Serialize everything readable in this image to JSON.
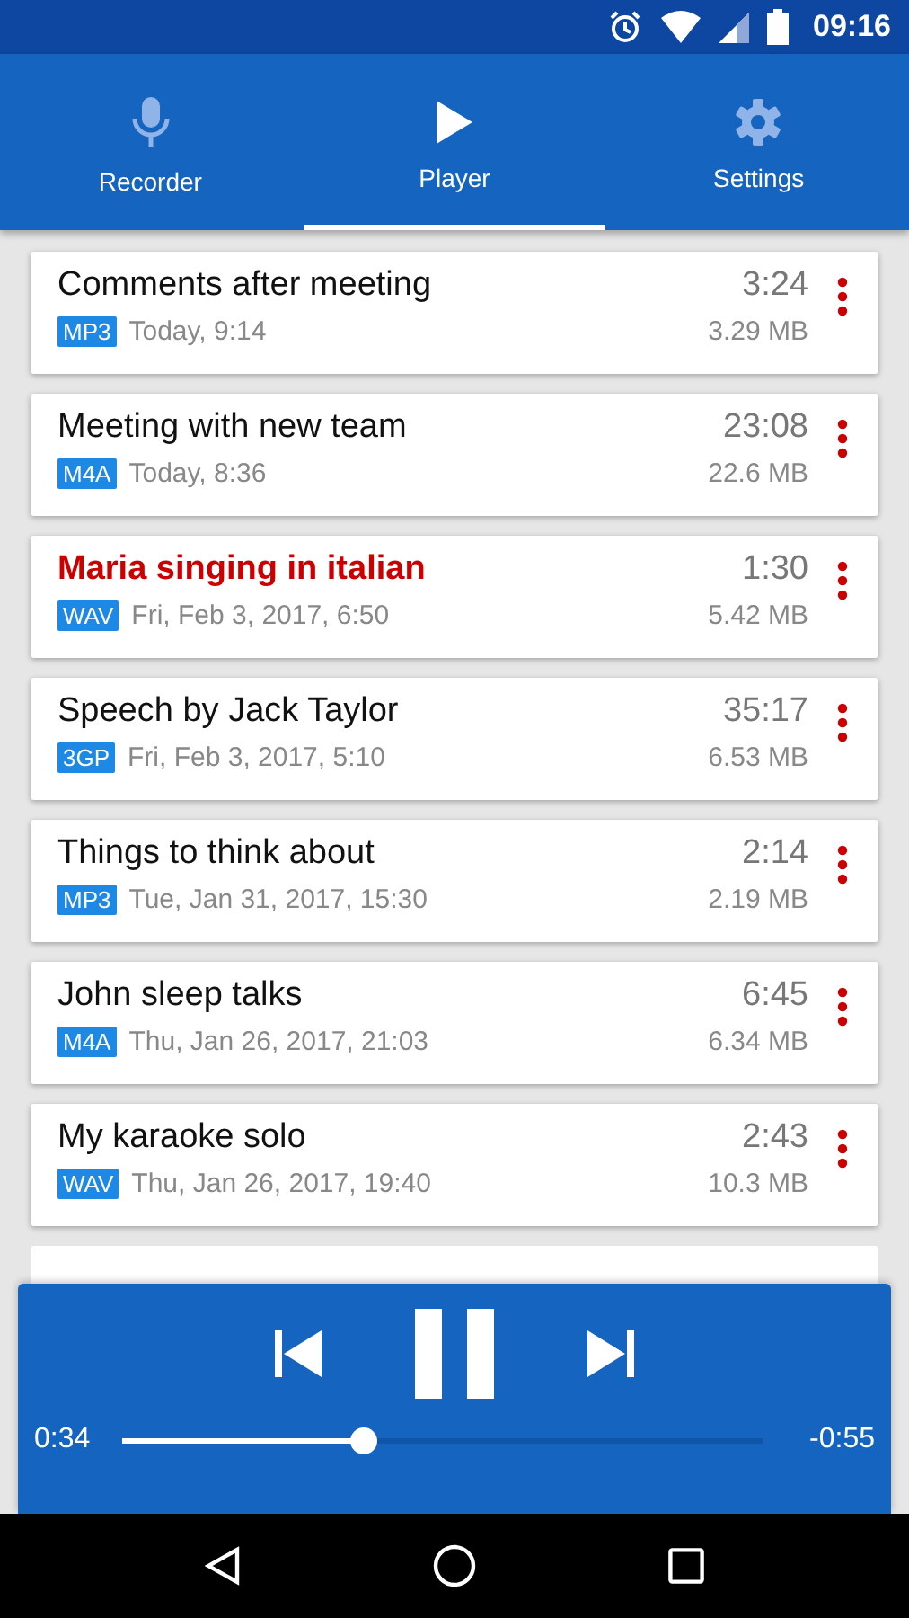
{
  "status_bar": {
    "time": "09:16"
  },
  "tabs": [
    {
      "label": "Recorder",
      "selected": false
    },
    {
      "label": "Player",
      "selected": true
    },
    {
      "label": "Settings",
      "selected": false
    }
  ],
  "recordings": [
    {
      "title": "Comments after meeting",
      "format": "MP3",
      "date": "Today, 9:14",
      "duration": "3:24",
      "size": "3.29 MB",
      "playing": false
    },
    {
      "title": "Meeting with new team",
      "format": "M4A",
      "date": "Today, 8:36",
      "duration": "23:08",
      "size": "22.6 MB",
      "playing": false
    },
    {
      "title": "Maria singing in italian",
      "format": "WAV",
      "date": "Fri, Feb 3, 2017, 6:50",
      "duration": "1:30",
      "size": "5.42 MB",
      "playing": true
    },
    {
      "title": "Speech by Jack Taylor",
      "format": "3GP",
      "date": "Fri, Feb 3, 2017, 5:10",
      "duration": "35:17",
      "size": "6.53 MB",
      "playing": false
    },
    {
      "title": "Things to think about",
      "format": "MP3",
      "date": "Tue, Jan 31, 2017, 15:30",
      "duration": "2:14",
      "size": "2.19 MB",
      "playing": false
    },
    {
      "title": "John sleep talks",
      "format": "M4A",
      "date": "Thu, Jan 26, 2017, 21:03",
      "duration": "6:45",
      "size": "6.34 MB",
      "playing": false
    },
    {
      "title": "My karaoke solo",
      "format": "WAV",
      "date": "Thu, Jan 26, 2017, 19:40",
      "duration": "2:43",
      "size": "10.3 MB",
      "playing": false
    }
  ],
  "player": {
    "elapsed": "0:34",
    "remaining": "-0:55",
    "level": 0.377,
    "paused": false
  }
}
